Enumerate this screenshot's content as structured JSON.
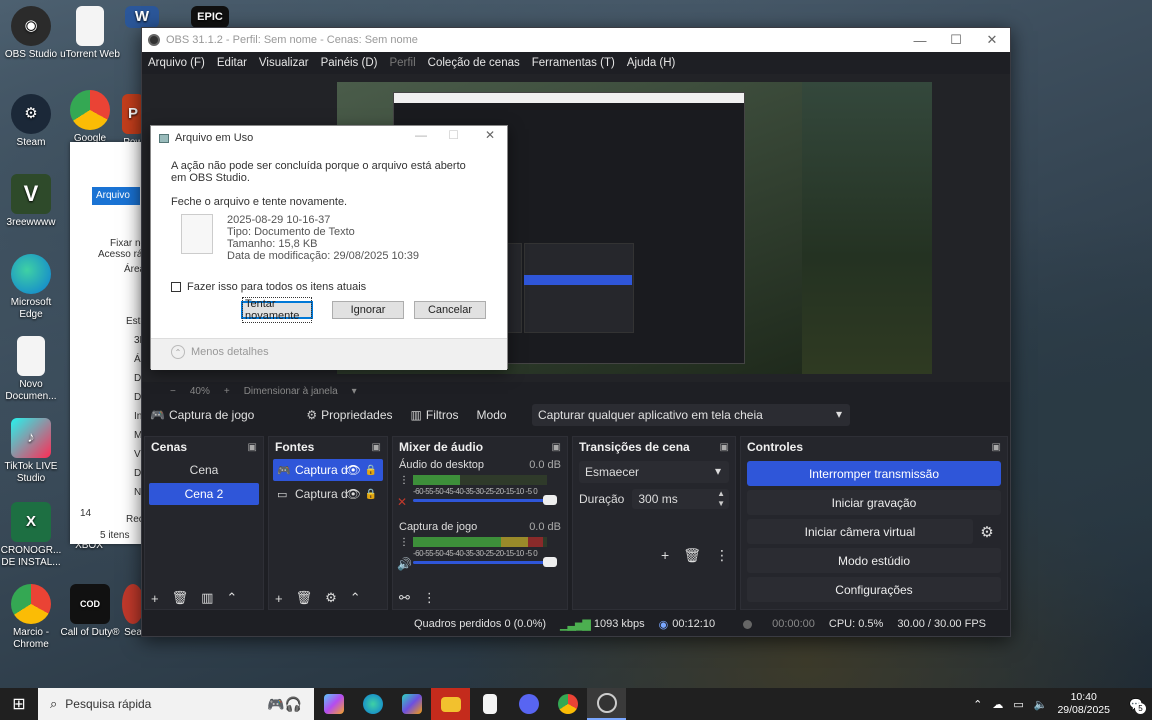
{
  "desktop": {
    "icons": [
      {
        "label": "OBS Studio",
        "icon": "obs-icon",
        "color": "#2b2b2b"
      },
      {
        "label": "uTorrent Web",
        "icon": "document-icon",
        "color": "#f4f4f4"
      },
      {
        "label": "Steam",
        "icon": "steam-icon",
        "color": "#1b2838"
      },
      {
        "label": "Google",
        "icon": "chrome-icon",
        "color": "#4285f4"
      },
      {
        "label": "Pow",
        "icon": "powerpoint-icon",
        "color": "#c43e1c"
      },
      {
        "label": "3reewwww",
        "icon": "gta-icon",
        "color": "#2e4a2a"
      },
      {
        "label": "Microsoft Edge",
        "icon": "edge-icon",
        "color": "#0c7cd5"
      },
      {
        "label": "Novo Documen...",
        "icon": "document-icon",
        "color": "#f4f4f4"
      },
      {
        "label": "TikTok LIVE Studio",
        "icon": "tiktok-icon",
        "color": "#e6194b"
      },
      {
        "label": "CRONOGR... DE INSTAL...",
        "icon": "excel-icon",
        "color": "#1d6f42"
      },
      {
        "label": "XBOX",
        "icon": "xbox-icon",
        "color": "#107c10"
      },
      {
        "label": "Marcio - Chrome",
        "icon": "chrome-icon",
        "color": "#4285f4"
      },
      {
        "label": "Call of Duty®",
        "icon": "cod-icon",
        "color": "#111111"
      },
      {
        "label": "Sea",
        "icon": "app-icon",
        "color": "#c0392b"
      }
    ],
    "word_icon": "W",
    "epic_label": "EPIC"
  },
  "explorer": {
    "tab_label": "Arquivo",
    "rows": [
      "Fixar no",
      "Acesso ráp",
      "Área",
      "Este",
      "3D",
      "Á",
      "D",
      "D",
      "In",
      "M",
      "Vi",
      "D",
      "N",
      "Rec",
      "14",
      "5 itens"
    ]
  },
  "obs": {
    "title": "OBS 31.1.2 - Perfil: Sem nome - Cenas: Sem nome",
    "menu": [
      {
        "label": "Arquivo (F)",
        "enabled": true
      },
      {
        "label": "Editar",
        "enabled": true
      },
      {
        "label": "Visualizar",
        "enabled": true
      },
      {
        "label": "Painéis (D)",
        "enabled": true
      },
      {
        "label": "Perfil",
        "enabled": false
      },
      {
        "label": "Coleção de cenas",
        "enabled": true
      },
      {
        "label": "Ferramentas (T)",
        "enabled": true
      },
      {
        "label": "Ajuda (H)",
        "enabled": true
      }
    ],
    "zoom": {
      "value": "40%",
      "fit": "Dimensionar à janela"
    },
    "source_toolbar": {
      "source_name": "Captura de jogo",
      "properties": "Propriedades",
      "filters": "Filtros",
      "mode_label": "Modo",
      "mode_value": "Capturar qualquer aplicativo em tela cheia"
    },
    "scenes": {
      "title": "Cenas",
      "items": [
        {
          "label": "Cena",
          "selected": false
        },
        {
          "label": "Cena 2",
          "selected": true
        }
      ]
    },
    "sources": {
      "title": "Fontes",
      "items": [
        {
          "label": "Captura d",
          "icon": "gamepad-icon",
          "selected": true
        },
        {
          "label": "Captura d",
          "icon": "monitor-icon",
          "selected": false
        }
      ]
    },
    "mixer": {
      "title": "Mixer de áudio",
      "channels": [
        {
          "name": "Áudio do desktop",
          "db": "0.0 dB",
          "level": 0.35
        },
        {
          "name": "Captura de jogo",
          "db": "0.0 dB",
          "level": 0.97
        }
      ],
      "ticks": "-60-55-50-45-40-35-30-25-20-15-10 -5 0"
    },
    "transitions": {
      "title": "Transições de cena",
      "selected": "Esmaecer",
      "duration_label": "Duração",
      "duration_value": "300 ms"
    },
    "controls": {
      "title": "Controles",
      "stop_stream": "Interromper transmissão",
      "start_rec": "Iniciar gravação",
      "virtual_cam": "Iniciar câmera virtual",
      "studio_mode": "Modo estúdio",
      "settings": "Configurações"
    },
    "status": {
      "dropped": "Quadros perdidos 0 (0.0%)",
      "bitrate": "1093 kbps",
      "stream_time": "00:12:10",
      "rec_time": "00:00:00",
      "cpu": "CPU: 0.5%",
      "fps": "30.00 / 30.00 FPS"
    }
  },
  "dialog": {
    "title": "Arquivo em Uso",
    "message": "A ação não pode ser concluída porque o arquivo está aberto em OBS Studio.",
    "hint": "Feche o arquivo e tente novamente.",
    "file_name": "2025-08-29 10-16-37",
    "file_type": "Tipo: Documento de Texto",
    "file_size": "Tamanho: 15,8 KB",
    "file_modified": "Data de modificação: 29/08/2025 10:39",
    "checkbox": "Fazer isso para todos os itens atuais",
    "retry": "Tentar novamente",
    "ignore": "Ignorar",
    "cancel": "Cancelar",
    "less_details": "Menos detalhes"
  },
  "taskbar": {
    "search_placeholder": "Pesquisa rápida",
    "apps": [
      {
        "icon": "copilot-icon",
        "color": "#b44cf0"
      },
      {
        "icon": "edge-icon",
        "color": "#0c7cd5"
      },
      {
        "icon": "copilot-m365-icon",
        "color": "#6e4fe0"
      },
      {
        "icon": "file-explorer-icon",
        "color": "#f2c12e"
      },
      {
        "icon": "notepad-icon",
        "color": "#f4f4f4"
      },
      {
        "icon": "discord-icon",
        "color": "#5865f2"
      },
      {
        "icon": "chrome-icon",
        "color": "#4285f4"
      },
      {
        "icon": "obs-icon",
        "color": "#333333"
      }
    ],
    "time": "10:40",
    "date": "29/08/2025",
    "notification_count": "5"
  }
}
